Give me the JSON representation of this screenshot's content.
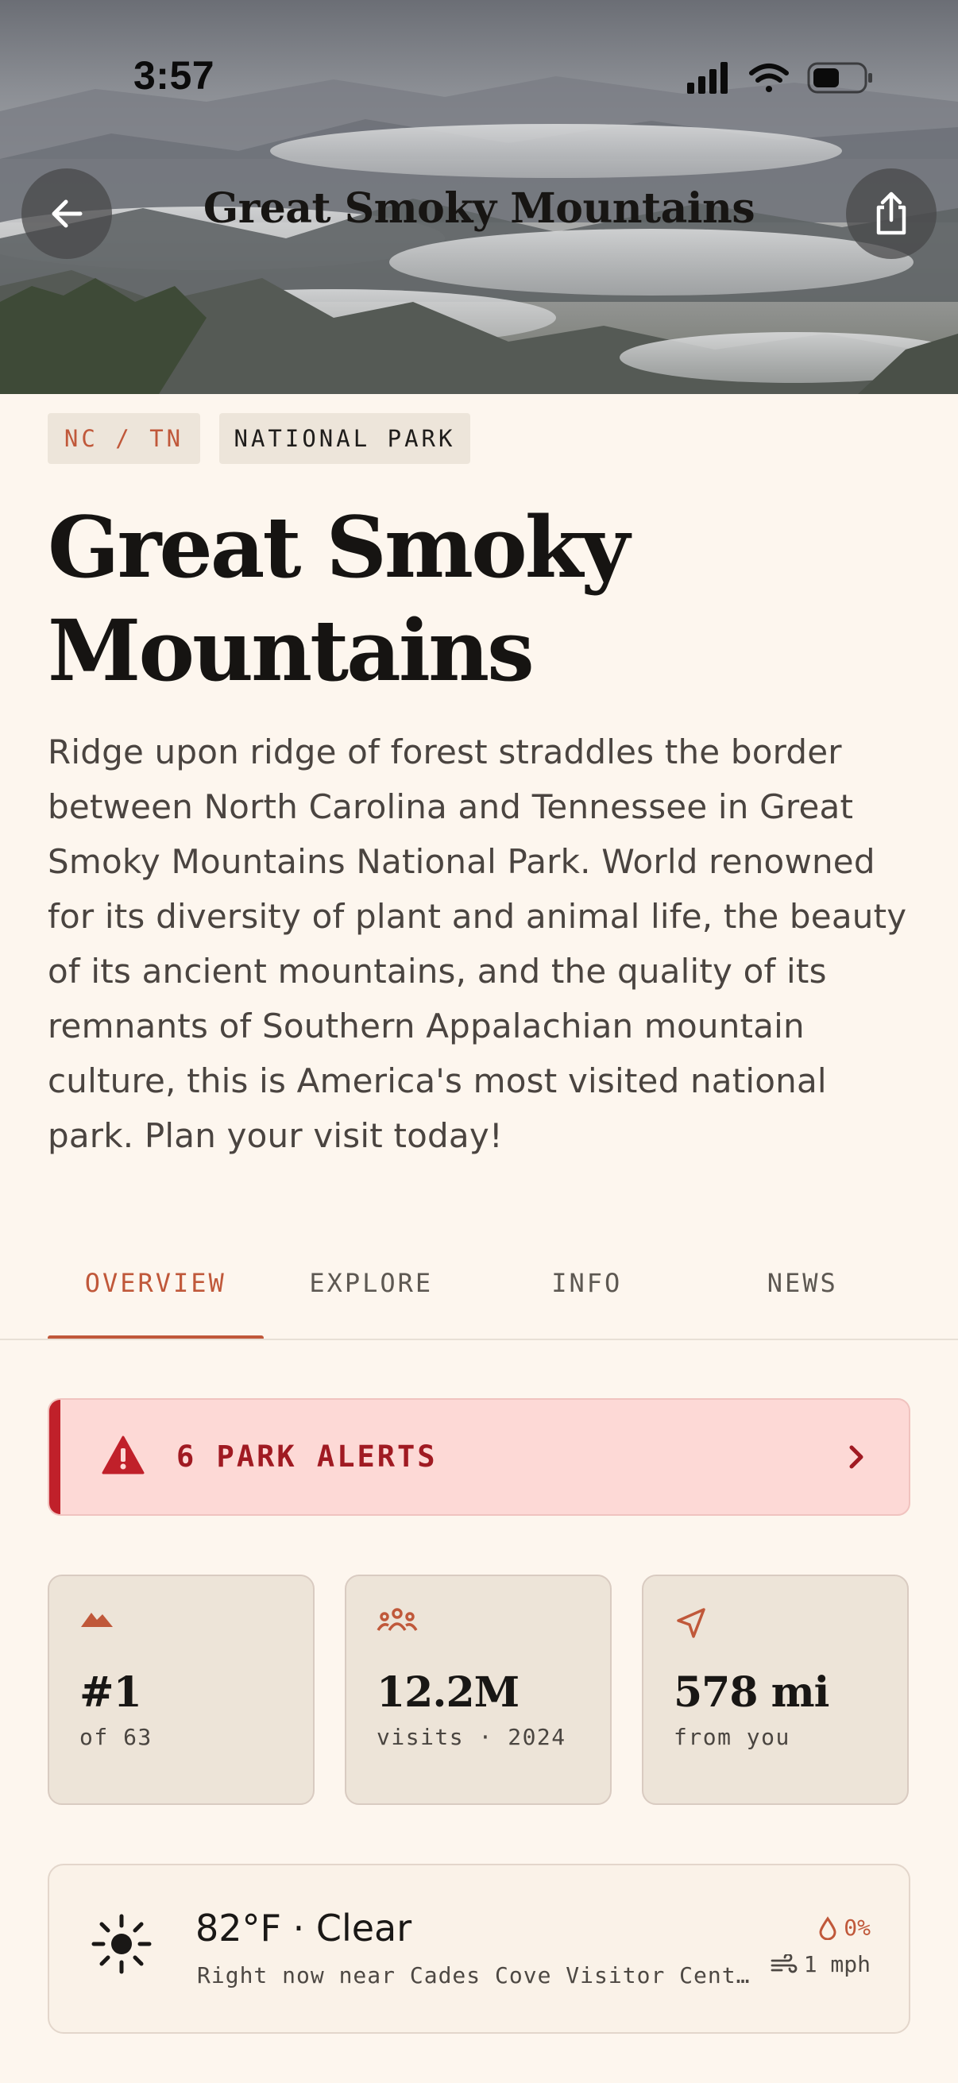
{
  "status_bar": {
    "time": "3:57"
  },
  "header": {
    "title": "Great Smoky Mountains"
  },
  "tags": {
    "state": "NC / TN",
    "type": "NATIONAL PARK"
  },
  "park": {
    "name": "Great Smoky Mountains",
    "description": "Ridge upon ridge of forest straddles the border between North Carolina and Tennessee in Great Smoky Mountains National Park. World renowned for its diversity of plant and animal life, the beauty of its ancient mountains, and the quality of its remnants of Southern Appalachian mountain culture, this is America's most visited national park. Plan your visit today!"
  },
  "tabs": [
    {
      "label": "OVERVIEW",
      "active": true
    },
    {
      "label": "EXPLORE",
      "active": false
    },
    {
      "label": "INFO",
      "active": false
    },
    {
      "label": "NEWS",
      "active": false
    }
  ],
  "alerts": {
    "label": "6 PARK ALERTS",
    "icon": "warning-triangle-icon"
  },
  "stats": [
    {
      "icon": "mountains-icon",
      "value": "#1",
      "sub": "of 63"
    },
    {
      "icon": "people-icon",
      "value": "12.2M",
      "sub": "visits · 2024"
    },
    {
      "icon": "location-arrow-icon",
      "value": "578 mi",
      "sub": "from you"
    }
  ],
  "weather": {
    "icon": "sun-icon",
    "summary": "82°F · Clear",
    "location": "Right now near Cades Cove Visitor Center",
    "precip": "0%",
    "wind": "1 mph"
  },
  "colors": {
    "accent": "#c0583a",
    "alert_text": "#a01a22",
    "alert_bg": "#fdd9d6",
    "background": "#fdf6ee"
  }
}
